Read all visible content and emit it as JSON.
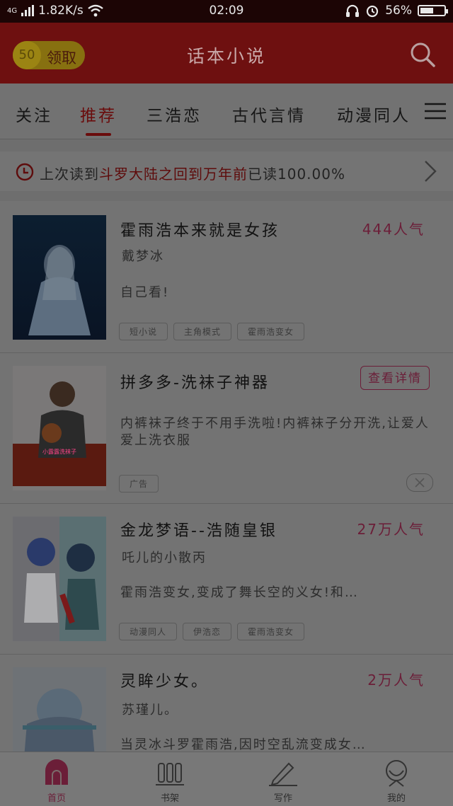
{
  "status_bar": {
    "network": "4G",
    "speed": "1.82K/s",
    "time": "02:09",
    "battery": "56%",
    "battery_level": 0.56
  },
  "header": {
    "coin_count": "50",
    "coin_label": "领取",
    "title": "话本小说"
  },
  "tabs": [
    {
      "label": "关注"
    },
    {
      "label": "推荐",
      "active": true
    },
    {
      "label": "三浩恋"
    },
    {
      "label": "古代言情"
    },
    {
      "label": "动漫同人"
    }
  ],
  "history": {
    "prefix": "上次读到",
    "book": "斗罗大陆之回到万年前",
    "suffix": "已读100.00%"
  },
  "items": [
    {
      "title": "霍雨浩本来就是女孩",
      "popularity": "444人气",
      "author": "戴梦冰",
      "description": "自己看!",
      "tags": [
        "短小说",
        "主角模式",
        "霍雨浩变女"
      ]
    },
    {
      "title": "拼多多-洗袜子神器",
      "button": "查看详情",
      "description": "内裤袜子终于不用手洗啦!内裤袜子分开洗,让爱人爱上洗衣服",
      "tags": [
        "广告"
      ],
      "cover_caption": "小露露洗袜子"
    },
    {
      "title": "金龙梦语--浩随皇银",
      "popularity": "27万人气",
      "author": "吒儿的小散丙",
      "description": "霍雨浩变女,变成了舞长空的义女!和…",
      "tags": [
        "动漫同人",
        "伊浩恋",
        "霍雨浩变女"
      ]
    },
    {
      "title": "灵眸少女。",
      "popularity": "2万人气",
      "author": "苏瑾儿。",
      "description": "当灵冰斗罗霍雨浩,因时空乱流变成女…"
    }
  ],
  "bottom_nav": [
    {
      "label": "首页",
      "icon": "home-icon",
      "active": true
    },
    {
      "label": "书架",
      "icon": "bookshelf-icon"
    },
    {
      "label": "写作",
      "icon": "pen-icon"
    },
    {
      "label": "我的",
      "icon": "profile-icon"
    }
  ],
  "colors": {
    "accent": "#e0355e",
    "header": "#c62222",
    "coin": "#f2c200"
  }
}
